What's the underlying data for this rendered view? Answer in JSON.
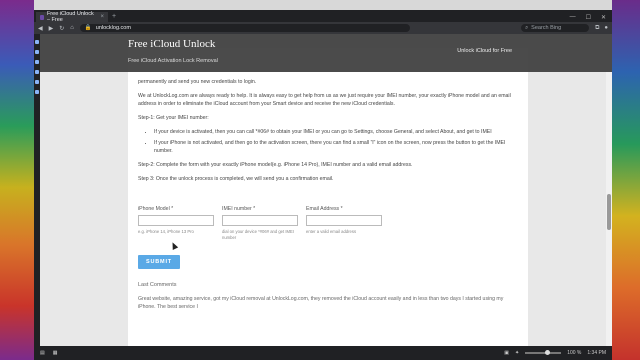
{
  "browser": {
    "tab_title": "Free iCloud Unlock – Free",
    "url": "unlocklog.com",
    "search_placeholder": "Search Bing"
  },
  "site": {
    "brand": "Free iCloud Unlock",
    "tagline": "Free iCloud Activation Lock Removal",
    "nav_link": "Unlock iCloud for Free"
  },
  "content": {
    "para1": "permanently and send you new credentials to login.",
    "para2": "We at UnlockLog.com are always ready to help. It is always easy to get help from us as we just require your IMEI number, your exactly iPhone model and an email address in order to eliminate the iCloud account from your Smart device and receive the new iCloud credentials.",
    "step1": "Step-1: Get your IMEI number:",
    "bullet1": "If your device is activated, then you can call *#06# to obtain your IMEI or you can go to Settings, choose General, and select About, and get to IMEI",
    "bullet2": "If your iPhone is not activated, and then go to the activation screen, there you can find a small \"i\" icon on the screen, now press the button to get the IMEI number.",
    "step2": "Step-2: Complete the form with your exactly iPhone model(e.g. iPhone 14 Pro), IMEI number and a valid email address.",
    "step3": "Step 3:  Once the unlock process is completed, we will send you a confirmation email."
  },
  "form": {
    "model_label": "iPhone Model *",
    "model_hint": "e.g. iPhone 14, iPhone 13 Pro",
    "imei_label": "IMEI number *",
    "imei_hint": "dial on your device *#06# and get IMEI number",
    "email_label": "Email Address *",
    "email_hint": "enter a valid email address",
    "submit_label": "SUBMIT"
  },
  "comments": {
    "title": "Last Comments",
    "text": "Great website, amazing service, got my iCloud removal at UnlockLog.com, they removed the iCloud account easily and in less than two days I started using my iPhone. The best service I"
  },
  "status": {
    "zoom": "100 %",
    "time": "1:34 PM"
  },
  "colors": {
    "header_bg": "#3c3c3c",
    "submit_bg": "#5aa9e6",
    "browser_chrome": "#202124"
  }
}
